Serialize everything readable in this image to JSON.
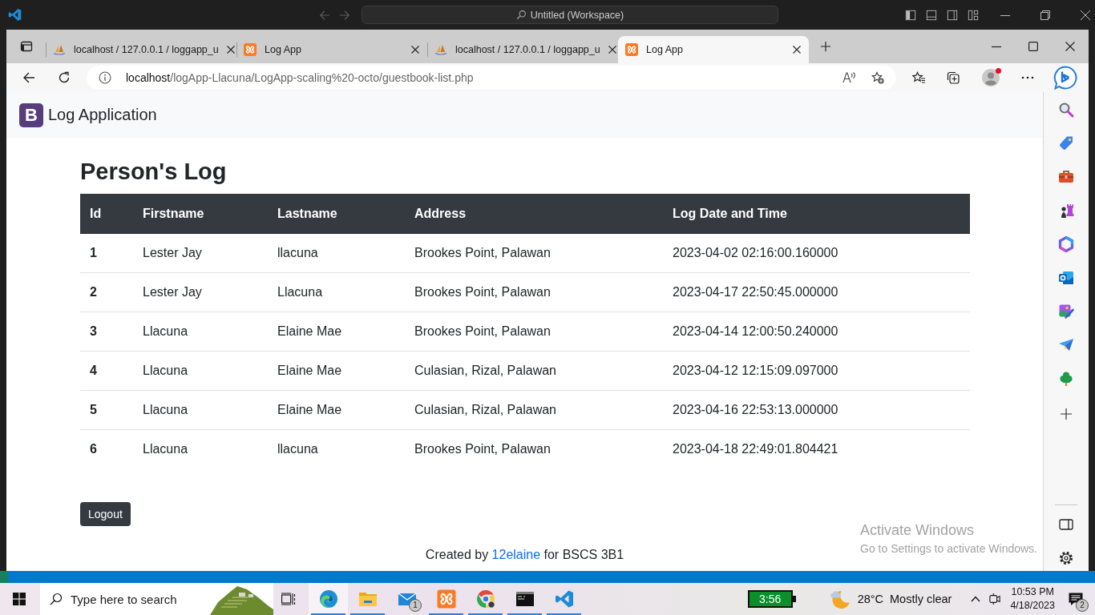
{
  "editor_titlebar": {
    "title": "Untitled (Workspace)"
  },
  "browser": {
    "tabs": [
      {
        "kind": "phpmyadmin",
        "title": "localhost / 127.0.0.1 / loggapp_u",
        "selected": false
      },
      {
        "kind": "xampp",
        "title": "Log App",
        "selected": false
      },
      {
        "kind": "phpmyadmin",
        "title": "localhost / 127.0.0.1 / loggapp_u",
        "selected": false
      },
      {
        "kind": "xampp",
        "title": "Log App",
        "selected": true
      }
    ],
    "address": {
      "host": "localhost",
      "path": "/logApp-Llacuna/LogApp-scaling%20-octo/guestbook-list.php"
    },
    "profile_alert": true
  },
  "page": {
    "logo_letter": "B",
    "brand": "Log Application",
    "heading": "Person's Log",
    "table": {
      "columns": [
        "Id",
        "Firstname",
        "Lastname",
        "Address",
        "Log Date and Time"
      ],
      "rows": [
        [
          "1",
          "Lester Jay",
          "llacuna",
          "Brookes Point, Palawan",
          "2023-04-02 02:16:00.160000"
        ],
        [
          "2",
          "Lester Jay",
          "Llacuna",
          "Brookes Point, Palawan",
          "2023-04-17 22:50:45.000000"
        ],
        [
          "3",
          "Llacuna",
          "Elaine Mae",
          "Brookes Point, Palawan",
          "2023-04-14 12:00:50.240000"
        ],
        [
          "4",
          "Llacuna",
          "Elaine Mae",
          "Culasian, Rizal, Palawan",
          "2023-04-12 12:15:09.097000"
        ],
        [
          "5",
          "Llacuna",
          "Elaine Mae",
          "Culasian, Rizal, Palawan",
          "2023-04-16 22:53:13.000000"
        ],
        [
          "6",
          "Llacuna",
          "llacuna",
          "Brookes Point, Palawan",
          "2023-04-18 22:49:01.804421"
        ]
      ]
    },
    "logout_button": "Logout",
    "footer": {
      "before": "Created by",
      "link": "12elaine",
      "after": "for BSCS 3B1"
    }
  },
  "activation_notice": {
    "title": "Activate Windows",
    "subtitle": "Go to Settings to activate Windows."
  },
  "taskbar": {
    "search": {
      "placeholder": "Type here to search"
    },
    "apps": [
      {
        "kind": "edge",
        "running": true,
        "selected": true
      },
      {
        "kind": "file-explorer",
        "running": true,
        "selected": false
      },
      {
        "kind": "mail",
        "running": false,
        "selected": false,
        "badge": "1"
      },
      {
        "kind": "xampp",
        "running": true,
        "selected": false
      },
      {
        "kind": "chrome",
        "running": true,
        "selected": false
      },
      {
        "kind": "terminal",
        "running": true,
        "selected": false
      },
      {
        "kind": "vscode",
        "running": true,
        "selected": false
      }
    ],
    "battery_timer": "3:56",
    "weather": {
      "temperature": "28°C",
      "condition": "Mostly clear"
    },
    "clock": {
      "time": "10:53 PM",
      "date": "4/18/2023"
    },
    "notification_count": "2"
  }
}
